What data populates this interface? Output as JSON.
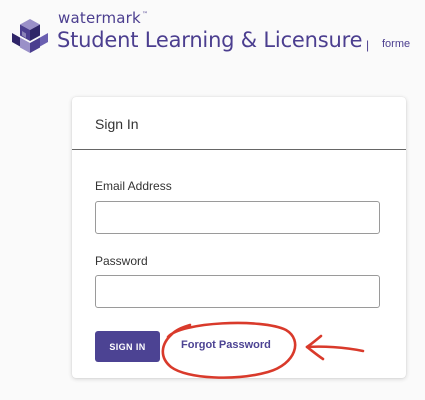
{
  "brand": {
    "name": "watermark",
    "tm": "™",
    "product": "Student Learning & Licensure",
    "separator": "|",
    "formerly": "forme"
  },
  "card": {
    "title": "Sign In",
    "email": {
      "label": "Email Address",
      "value": "",
      "placeholder": ""
    },
    "password": {
      "label": "Password",
      "value": "",
      "placeholder": ""
    },
    "signin_label": "SIGN IN",
    "forgot_label": "Forgot Password"
  },
  "colors": {
    "brand_purple": "#4b3e8f",
    "button_purple": "#4c4393",
    "annotation_red": "#d93a2b"
  },
  "icons": {
    "logo": "watermark-cube-logo-icon",
    "annotation_circle": "red-circle-annotation-icon",
    "annotation_arrow": "red-arrow-annotation-icon"
  }
}
